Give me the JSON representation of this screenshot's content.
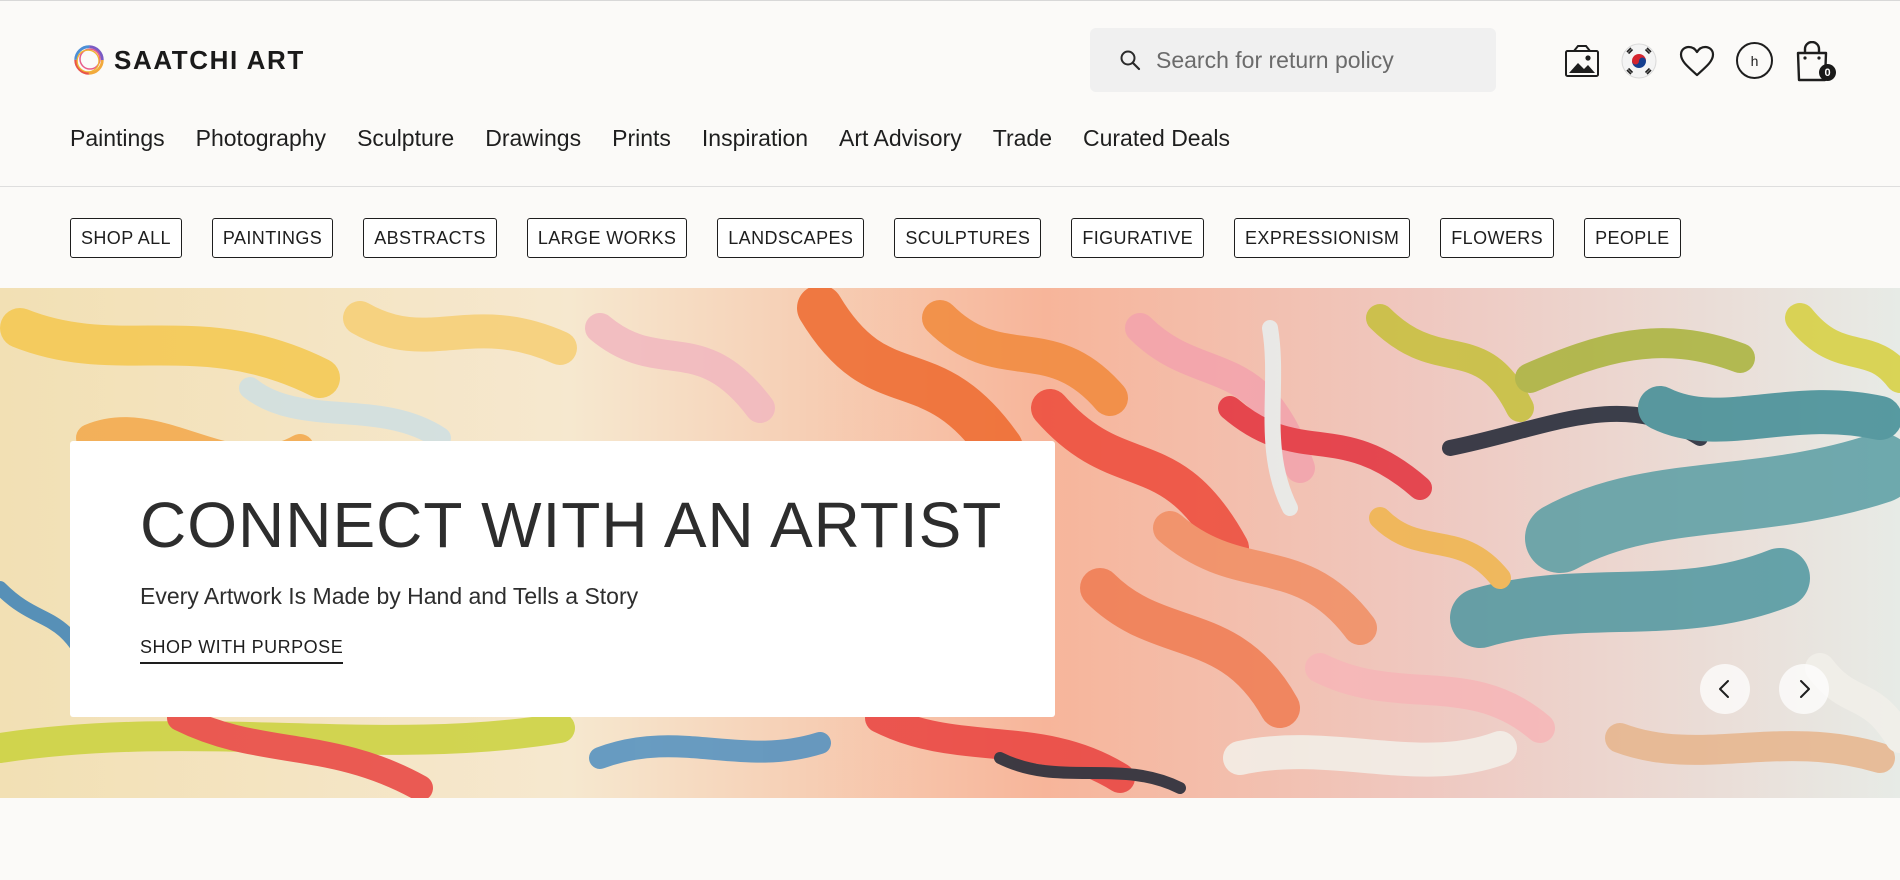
{
  "brand": {
    "name": "SAATCHI ART"
  },
  "search": {
    "placeholder": "Search for return policy"
  },
  "header_icons": {
    "gallery": "gallery-icon",
    "region": "south-korea-flag-icon",
    "favorites": "heart-icon",
    "account": {
      "icon": "avatar-icon",
      "initial": "h"
    },
    "cart": {
      "icon": "shopping-bag-icon",
      "count": "0"
    }
  },
  "main_nav": [
    "Paintings",
    "Photography",
    "Sculpture",
    "Drawings",
    "Prints",
    "Inspiration",
    "Art Advisory",
    "Trade",
    "Curated Deals"
  ],
  "categories": [
    "SHOP ALL",
    "PAINTINGS",
    "ABSTRACTS",
    "LARGE WORKS",
    "LANDSCAPES",
    "SCULPTURES",
    "FIGURATIVE",
    "EXPRESSIONISM",
    "FLOWERS",
    "PEOPLE"
  ],
  "hero": {
    "title": "CONNECT WITH AN ARTIST",
    "subtitle": "Every Artwork Is Made by Hand and Tells a Story",
    "cta": "SHOP WITH PURPOSE",
    "prev_icon": "chevron-left-icon",
    "next_icon": "chevron-right-icon"
  },
  "colors": {
    "page_background": "#fbfaf8",
    "text": "#1e1e1e",
    "search_background": "#f0f0f0",
    "hero_palette": [
      "#f3a24c",
      "#e9423f",
      "#f6b6b8",
      "#5a9ea4",
      "#cbc83a",
      "#1d2433"
    ]
  }
}
